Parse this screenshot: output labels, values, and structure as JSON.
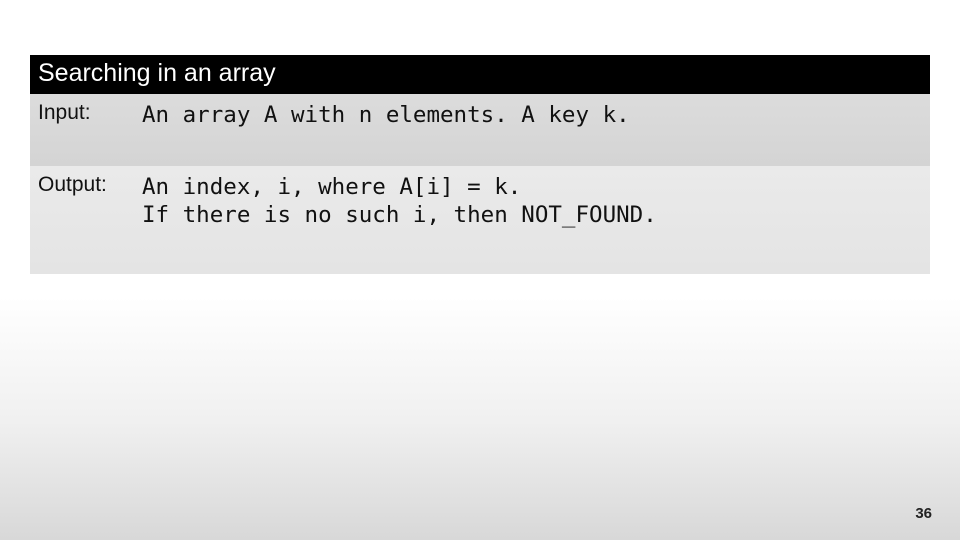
{
  "title": "Searching in an array",
  "rows": [
    {
      "label": "Input:",
      "value": "An array A with n elements. A key k."
    },
    {
      "label": "Output:",
      "value": "An index, i, where A[i] = k.\nIf there is no such i, then NOT_FOUND."
    }
  ],
  "page_number": "36"
}
